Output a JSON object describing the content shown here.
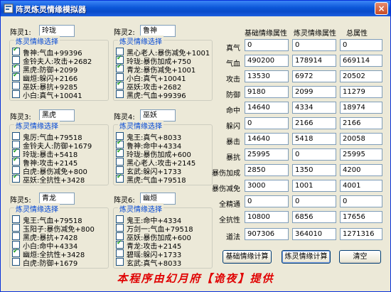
{
  "window": {
    "title": "阵灵炼灵情缘模拟器",
    "close_label": "×"
  },
  "select_title": "炼灵情缘选择",
  "slots": [
    {
      "label": "阵灵1:",
      "value": "玲珑",
      "options": [
        {
          "text": "鲁神:气血+99396",
          "checked": true
        },
        {
          "text": "金铃夫人:攻击+2682",
          "checked": false
        },
        {
          "text": "黑虎:防御+2099",
          "checked": true
        },
        {
          "text": "幽烜:躲闪+2166",
          "checked": true
        },
        {
          "text": "巫妖:暴抗+9285",
          "checked": false
        },
        {
          "text": "小白:真气+10041",
          "checked": false
        }
      ]
    },
    {
      "label": "阵灵2:",
      "value": "鲁神",
      "options": [
        {
          "text": "黑心老人:暴伤减免+1001",
          "checked": false
        },
        {
          "text": "玲珑:暴伤加成+750",
          "checked": true
        },
        {
          "text": "青龙:暴伤减免+1001",
          "checked": true
        },
        {
          "text": "小白:真气+10041",
          "checked": false
        },
        {
          "text": "巫妖:攻击+2682",
          "checked": true
        },
        {
          "text": "黑虎:气血+99396",
          "checked": false
        }
      ]
    },
    {
      "label": "阵灵3:",
      "value": "黑虎",
      "options": [
        {
          "text": "鬼厉:气血+79518",
          "checked": false
        },
        {
          "text": "金铃夫人:防御+1679",
          "checked": false
        },
        {
          "text": "玲珑:暴击+5418",
          "checked": true
        },
        {
          "text": "鲁神:攻击+2145",
          "checked": true
        },
        {
          "text": "白虎:暴伤减免+800",
          "checked": false
        },
        {
          "text": "巫妖:全抗性+3428",
          "checked": true
        }
      ]
    },
    {
      "label": "阵灵4:",
      "value": "巫妖",
      "options": [
        {
          "text": "鬼王:真气+8033",
          "checked": false
        },
        {
          "text": "鲁神:命中+4334",
          "checked": true
        },
        {
          "text": "玲珑:暴伤加成+600",
          "checked": true
        },
        {
          "text": "黑心老人:攻击+2145",
          "checked": false
        },
        {
          "text": "玄武:躲闪+1733",
          "checked": false
        },
        {
          "text": "黑虎:气血+79518",
          "checked": true
        }
      ]
    },
    {
      "label": "阵灵5:",
      "value": "青龙",
      "options": [
        {
          "text": "鬼王:气血+79518",
          "checked": false
        },
        {
          "text": "玉阳子:暴伤减免+800",
          "checked": false
        },
        {
          "text": "黑虎:暴抗+7428",
          "checked": false
        },
        {
          "text": "小白:命中+4334",
          "checked": false
        },
        {
          "text": "幽烜:全抗性+3428",
          "checked": true
        },
        {
          "text": "白虎:防御+1679",
          "checked": false
        }
      ]
    },
    {
      "label": "阵灵6:",
      "value": "幽烜",
      "options": [
        {
          "text": "鬼王:命中+4334",
          "checked": false
        },
        {
          "text": "万剑一:气血+79518",
          "checked": false
        },
        {
          "text": "巫妖:暴伤加成+600",
          "checked": false
        },
        {
          "text": "青龙:攻击+2145",
          "checked": true
        },
        {
          "text": "碧瑶:躲闪+1733",
          "checked": false
        },
        {
          "text": "玄武:真气+8033",
          "checked": false
        }
      ]
    }
  ],
  "stats": {
    "headers": [
      "基础情缘属性",
      "炼灵情缘属性",
      "总属性"
    ],
    "rows": [
      {
        "name": "真气",
        "base": "0",
        "lianling": "0",
        "total": "0"
      },
      {
        "name": "气血",
        "base": "490200",
        "lianling": "178914",
        "total": "669114"
      },
      {
        "name": "攻击",
        "base": "13530",
        "lianling": "6972",
        "total": "20502"
      },
      {
        "name": "防御",
        "base": "9180",
        "lianling": "2099",
        "total": "11279"
      },
      {
        "name": "命中",
        "base": "14640",
        "lianling": "4334",
        "total": "18974"
      },
      {
        "name": "躲闪",
        "base": "0",
        "lianling": "2166",
        "total": "2166"
      },
      {
        "name": "暴击",
        "base": "14640",
        "lianling": "5418",
        "total": "20058"
      },
      {
        "name": "暴抗",
        "base": "25995",
        "lianling": "0",
        "total": "25995"
      },
      {
        "name": "暴伤加成",
        "base": "2850",
        "lianling": "1350",
        "total": "4200"
      },
      {
        "name": "暴伤减免",
        "base": "3000",
        "lianling": "1001",
        "total": "4001"
      },
      {
        "name": "全精通",
        "base": "0",
        "lianling": "0",
        "total": "0"
      },
      {
        "name": "全抗性",
        "base": "10800",
        "lianling": "6856",
        "total": "17656"
      },
      {
        "name": "道法",
        "base": "907306",
        "lianling": "364010",
        "total": "1271316"
      }
    ]
  },
  "buttons": {
    "basic_calc": "基础情缘计算",
    "lianling_calc": "炼灵情缘计算",
    "clear": "清空"
  },
  "footer": "本程序由幻月府【诡夜】提供",
  "colors": {
    "title_bar": "#0b56d8",
    "group_title": "#0046d5",
    "footer": "#e00000",
    "check": "#21a121"
  }
}
